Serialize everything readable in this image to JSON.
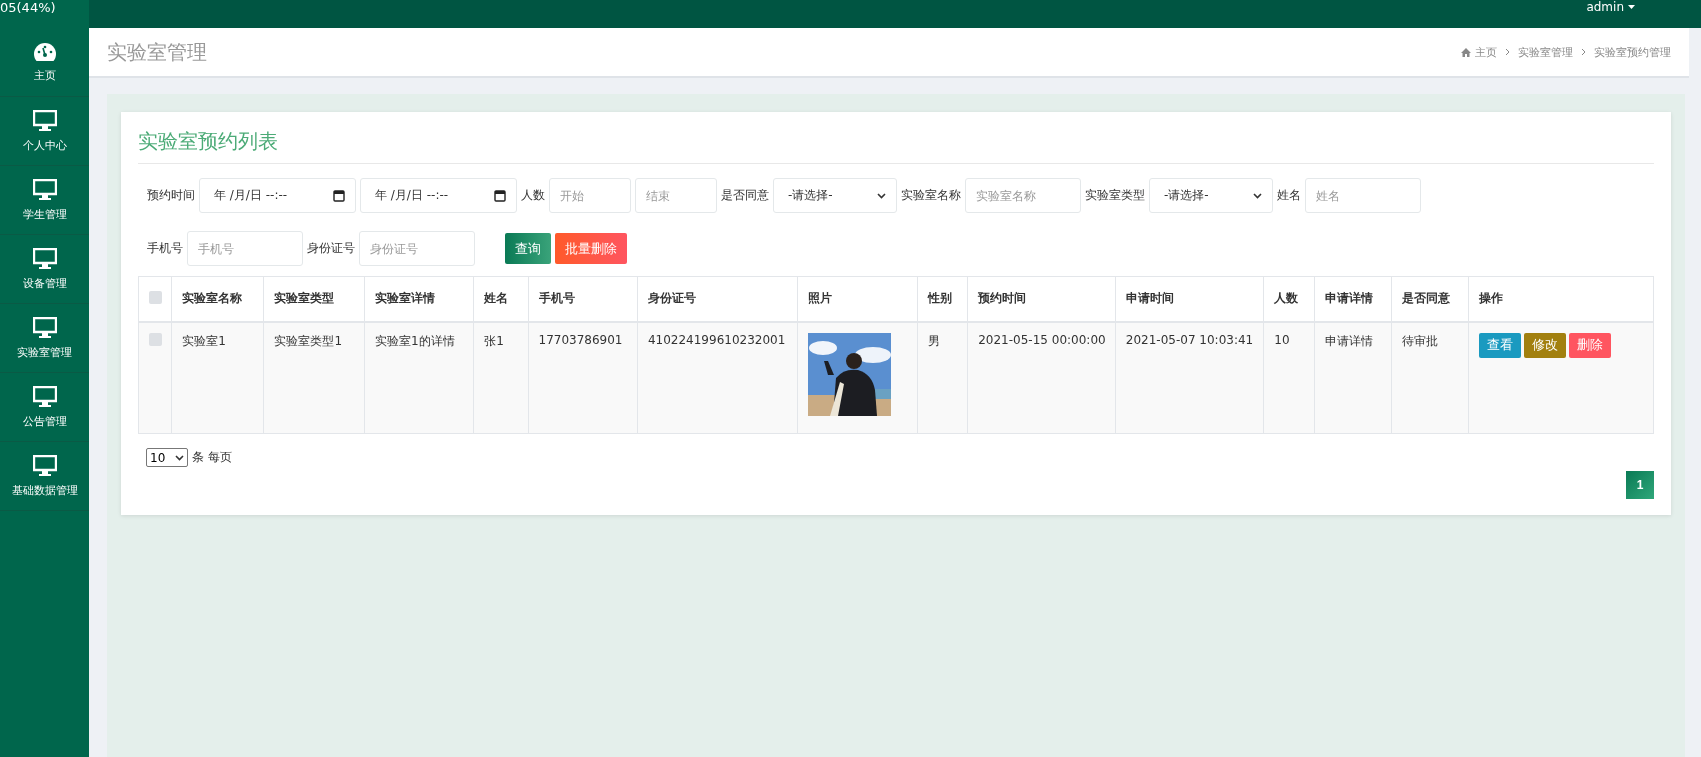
{
  "overlay_text": "05(44%)",
  "topbar": {
    "user": "admin"
  },
  "sidebar": {
    "items": [
      {
        "label": "主页",
        "kind": "dashboard"
      },
      {
        "label": "个人中心",
        "kind": "monitor"
      },
      {
        "label": "学生管理",
        "kind": "monitor"
      },
      {
        "label": "设备管理",
        "kind": "monitor"
      },
      {
        "label": "实验室管理",
        "kind": "monitor"
      },
      {
        "label": "公告管理",
        "kind": "monitor"
      },
      {
        "label": "基础数据管理",
        "kind": "monitor"
      }
    ]
  },
  "header": {
    "title": "实验室管理",
    "breadcrumb": [
      "主页",
      "实验室管理",
      "实验室预约管理"
    ]
  },
  "panel": {
    "title": "实验室预约列表",
    "filters": [
      {
        "kind": "label",
        "text": "预约时间"
      },
      {
        "kind": "date",
        "value": "年 /月/日 --:--"
      },
      {
        "kind": "date",
        "value": "年 /月/日 --:--"
      },
      {
        "kind": "label",
        "text": "人数"
      },
      {
        "kind": "input",
        "placeholder": "开始"
      },
      {
        "kind": "input",
        "placeholder": "结束"
      },
      {
        "kind": "label",
        "text": "是否同意"
      },
      {
        "kind": "select",
        "value": "-请选择-"
      },
      {
        "kind": "label",
        "text": "实验室名称"
      },
      {
        "kind": "input",
        "placeholder": "实验室名称"
      },
      {
        "kind": "label",
        "text": "实验室类型"
      },
      {
        "kind": "select",
        "value": "-请选择-"
      },
      {
        "kind": "label",
        "text": "姓名"
      },
      {
        "kind": "input",
        "placeholder": "姓名"
      },
      {
        "kind": "break"
      },
      {
        "kind": "label",
        "text": "手机号"
      },
      {
        "kind": "input",
        "placeholder": "手机号"
      },
      {
        "kind": "label",
        "text": "身份证号"
      },
      {
        "kind": "input",
        "placeholder": "身份证号"
      },
      {
        "kind": "search",
        "text": "查询"
      },
      {
        "kind": "delete",
        "text": "批量删除"
      }
    ],
    "table": {
      "header_checked": false,
      "columns": [
        "实验室名称",
        "实验室类型",
        "实验室详情",
        "姓名",
        "手机号",
        "身份证号",
        "照片",
        "性别",
        "预约时间",
        "申请时间",
        "人数",
        "申请详情",
        "是否同意",
        "操作"
      ],
      "rows": [
        {
          "checked": false,
          "cells": [
            "实验室1",
            "实验室类型1",
            "实验室1的详情",
            "张1",
            "17703786901",
            "410224199610232001",
            {
              "kind": "picture"
            },
            "男",
            "2021-05-15 00:00:00",
            "2021-05-07 10:03:41",
            "10",
            "申请详情",
            "待审批"
          ],
          "actions": [
            {
              "kind": "view",
              "label": "查看"
            },
            {
              "kind": "edit",
              "label": "修改"
            },
            {
              "kind": "delete",
              "label": "删除"
            }
          ]
        }
      ]
    },
    "page_size": {
      "value": "10",
      "suffix": "条 每页"
    },
    "pages": [
      {
        "label": "1",
        "selected": true
      }
    ]
  }
}
